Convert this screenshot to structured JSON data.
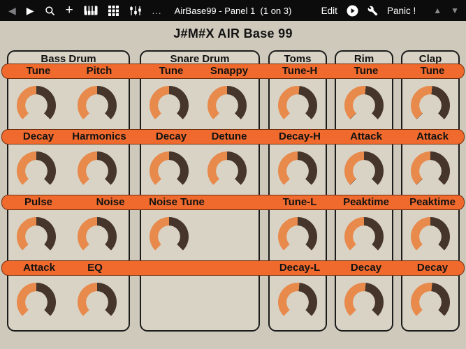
{
  "toolbar": {
    "title": "AirBase99 - Panel 1  (1 on 3)",
    "edit_label": "Edit",
    "panic_label": "Panic !",
    "more_label": "..."
  },
  "panel": {
    "title": "J#M#X AIR Base 99",
    "section_headers": [
      "Bass Drum",
      "Snare Drum",
      "Toms",
      "Rim",
      "Clap"
    ],
    "rows": [
      {
        "labels": [
          "Tune",
          "Pitch",
          "Tune",
          "Snappy",
          "Tune-H",
          "Tune",
          "Tune"
        ],
        "knob_values": [
          0.5,
          0.5,
          0.5,
          0.5,
          0.52,
          0.52,
          0.52
        ]
      },
      {
        "labels": [
          "Decay",
          "Harmonics",
          "Decay",
          "Detune",
          "Decay-H",
          "Attack",
          "Attack"
        ],
        "knob_values": [
          0.5,
          0.5,
          0.5,
          0.5,
          0.5,
          0.5,
          0.5
        ]
      },
      {
        "labels": [
          "Pulse",
          "Noise",
          "Noise Tune",
          null,
          "Tune-L",
          "Peaktime",
          "Peaktime"
        ],
        "knob_values": [
          0.5,
          0.5,
          0.5,
          null,
          0.5,
          0.5,
          0.5
        ]
      },
      {
        "labels": [
          "Attack",
          "EQ",
          null,
          null,
          "Decay-L",
          "Decay",
          "Decay"
        ],
        "knob_values": [
          0.5,
          0.5,
          null,
          null,
          0.52,
          0.52,
          0.52
        ]
      }
    ]
  },
  "colors": {
    "page_bg": "#CFC9BC",
    "panel_bg": "#D9D3C6",
    "accent_orange": "#F06A2D",
    "knob_orange": "#E78A4C",
    "knob_brown": "#46352A",
    "toolbar_bg": "#0C0C0C"
  }
}
